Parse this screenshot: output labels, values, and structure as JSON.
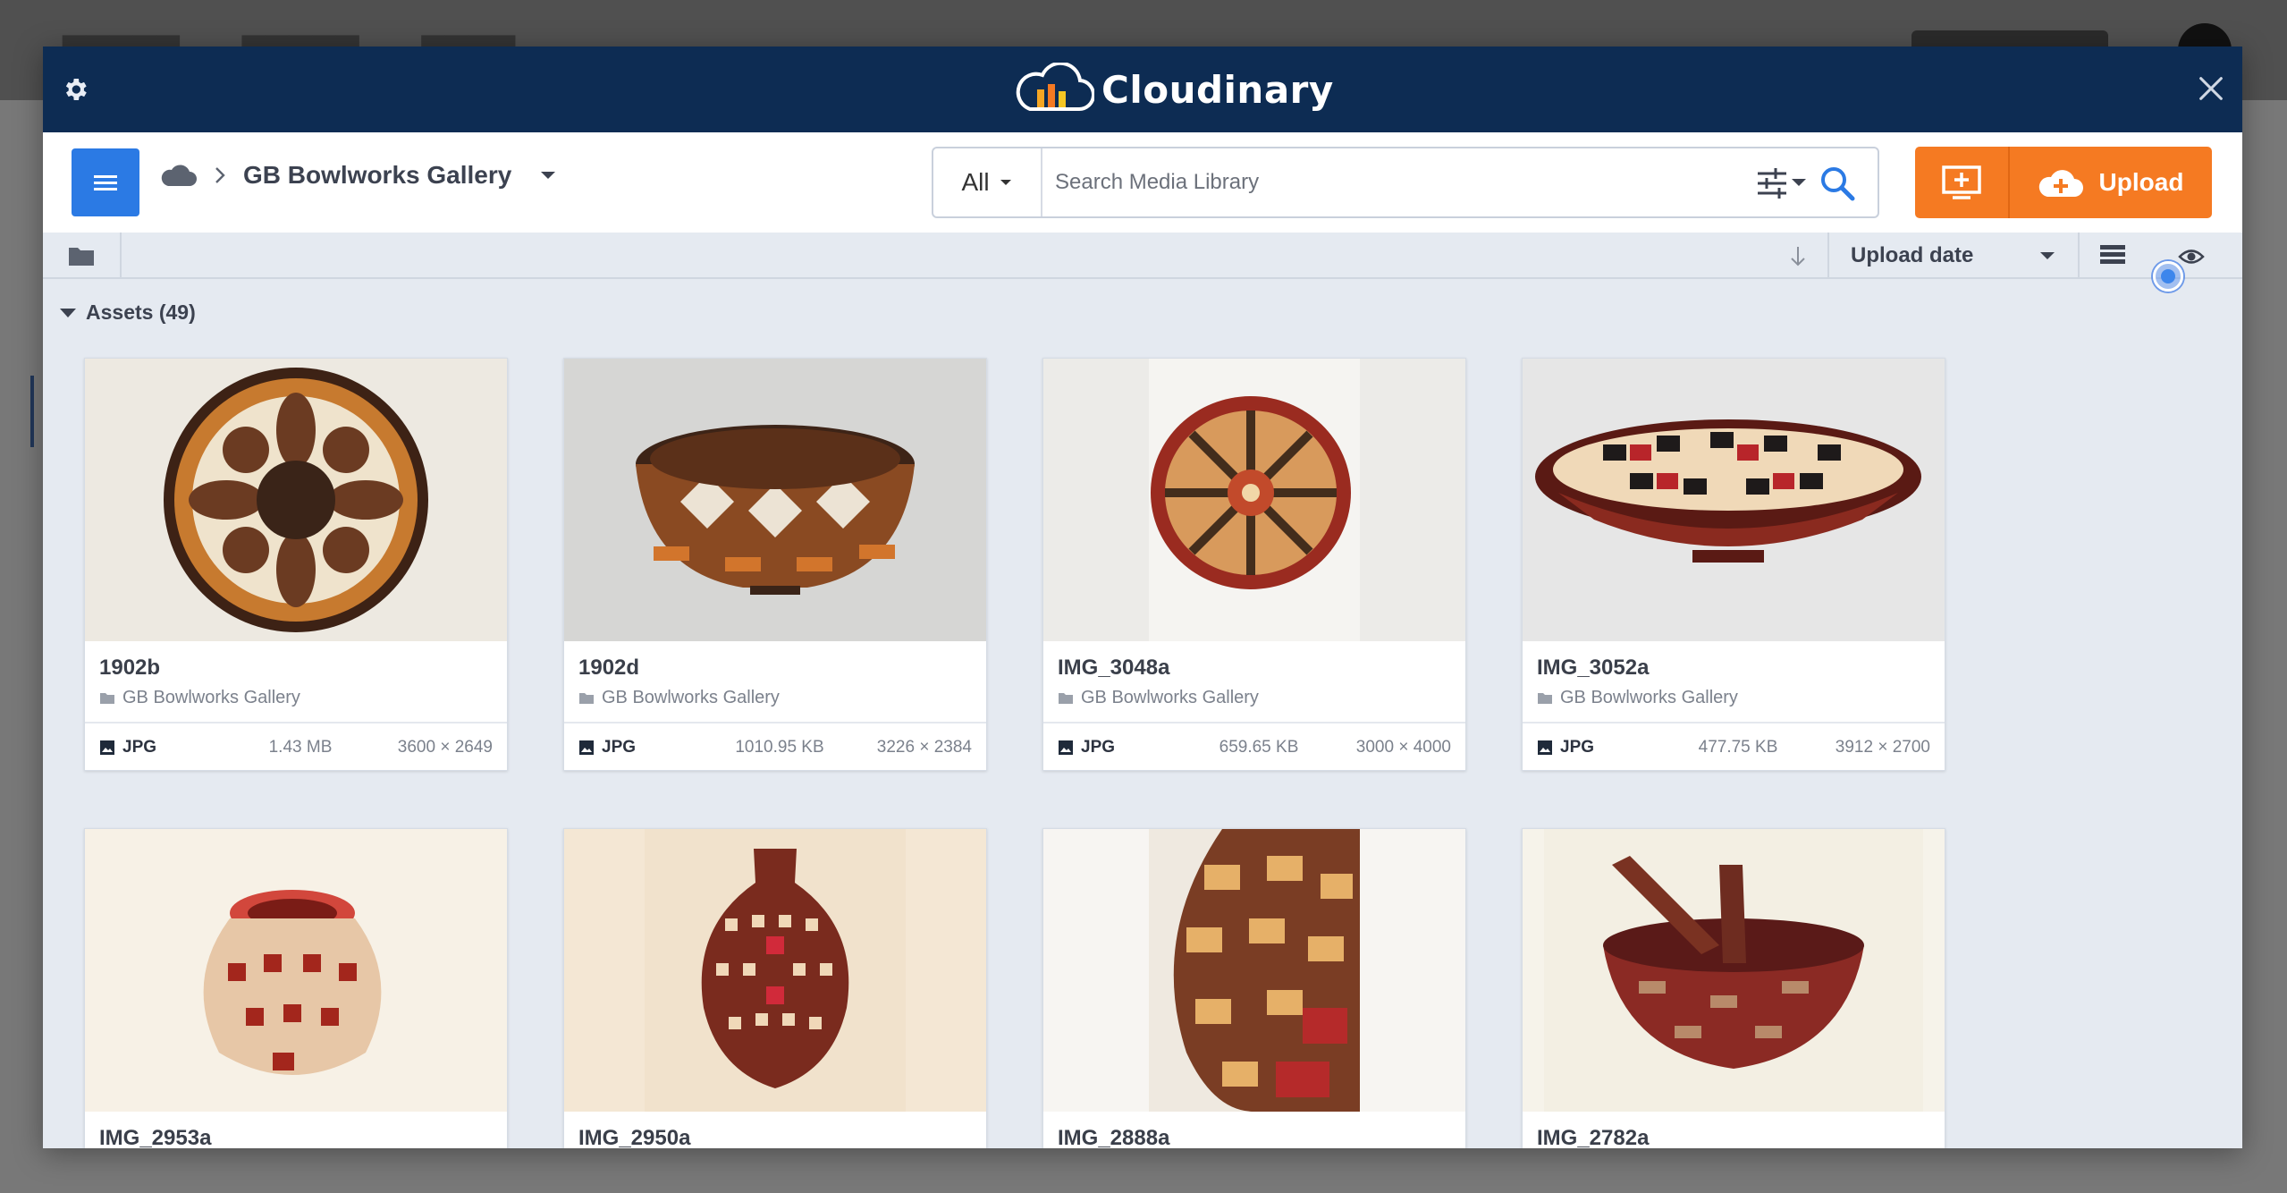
{
  "header": {
    "brand": "Cloudinary"
  },
  "toolbar": {
    "breadcrumb_folder": "GB Bowlworks Gallery",
    "search": {
      "scope": "All",
      "placeholder": "Search Media Library"
    },
    "upload_label": "Upload"
  },
  "subbar": {
    "sort_by": "Upload date"
  },
  "section": {
    "title": "Assets (49)"
  },
  "colors": {
    "header_bg": "#0d2c53",
    "accent_blue": "#2b7ae4",
    "upload_orange": "#f57a22",
    "content_bg": "#e5eaf1"
  },
  "assets": [
    {
      "name": "1902b",
      "folder": "GB Bowlworks Gallery",
      "type": "JPG",
      "size": "1.43 MB",
      "dims": "3600 × 2649"
    },
    {
      "name": "1902d",
      "folder": "GB Bowlworks Gallery",
      "type": "JPG",
      "size": "1010.95 KB",
      "dims": "3226 × 2384"
    },
    {
      "name": "IMG_3048a",
      "folder": "GB Bowlworks Gallery",
      "type": "JPG",
      "size": "659.65 KB",
      "dims": "3000 × 4000"
    },
    {
      "name": "IMG_3052a",
      "folder": "GB Bowlworks Gallery",
      "type": "JPG",
      "size": "477.75 KB",
      "dims": "3912 × 2700"
    },
    {
      "name": "IMG_2953a"
    },
    {
      "name": "IMG_2950a"
    },
    {
      "name": "IMG_2888a"
    },
    {
      "name": "IMG_2782a"
    }
  ]
}
